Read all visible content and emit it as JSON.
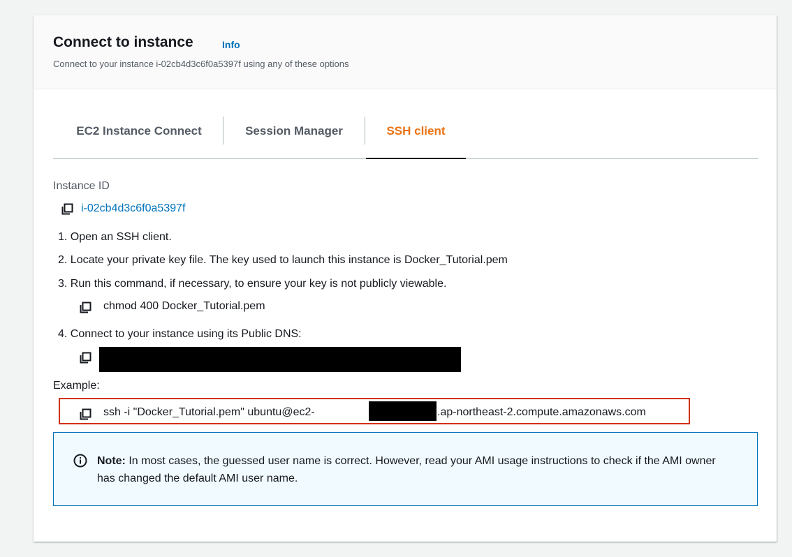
{
  "header": {
    "title": "Connect to instance",
    "info_label": "Info",
    "subtitle": "Connect to your instance i-02cb4d3c6f0a5397f using any of these options"
  },
  "tabs": [
    {
      "label": "EC2 Instance Connect",
      "active": false
    },
    {
      "label": "Session Manager",
      "active": false
    },
    {
      "label": "SSH client",
      "active": true
    }
  ],
  "instance": {
    "label": "Instance ID",
    "id": "i-02cb4d3c6f0a5397f"
  },
  "steps": [
    "1. Open an SSH client.",
    "2. Locate your private key file. The key used to launch this instance is Docker_Tutorial.pem",
    "3. Run this command, if necessary, to ensure your key is not publicly viewable.",
    "4. Connect to your instance using its Public DNS:"
  ],
  "chmod_command": "chmod 400 Docker_Tutorial.pem",
  "example": {
    "label": "Example:",
    "command_prefix": "ssh -i \"Docker_Tutorial.pem\" ubuntu@ec2-",
    "command_suffix": ".ap-northeast-2.compute.amazonaws.com"
  },
  "note": {
    "bold": "Note:",
    "text": "In most cases, the guessed user name is correct. However, read your AMI usage instructions to check if the AMI owner has changed the default AMI user name."
  },
  "colors": {
    "link": "#0073bb",
    "active_tab": "#ec7211",
    "highlight_border": "#d13212",
    "note_bg": "#f1faff"
  },
  "icons": [
    "copy-icon",
    "info-circle-icon"
  ]
}
